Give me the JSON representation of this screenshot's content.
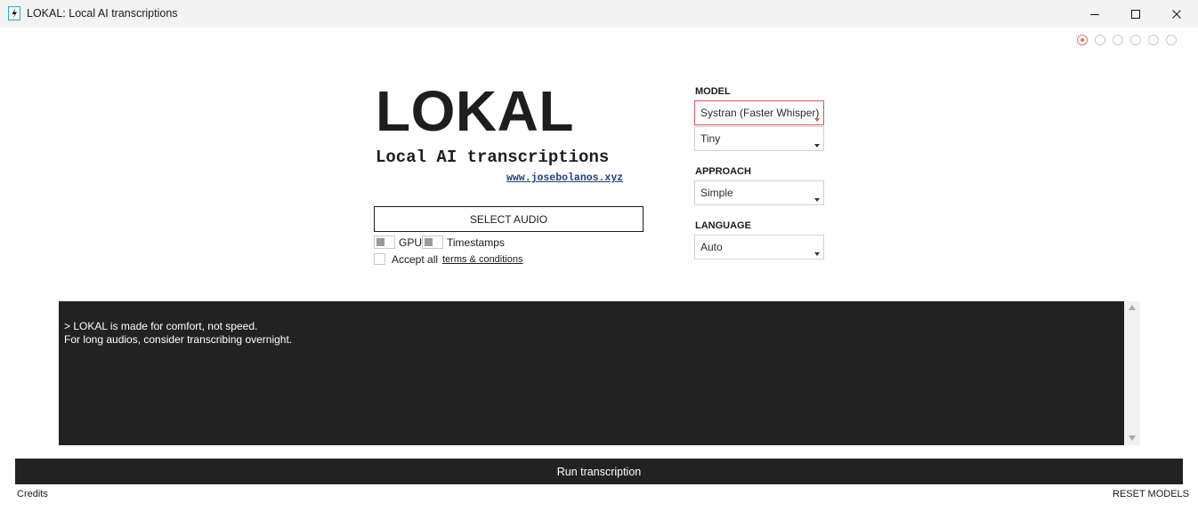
{
  "window": {
    "title": "LOKAL: Local AI transcriptions",
    "minimize_icon": "minimize-icon",
    "maximize_icon": "maximize-icon",
    "close_icon": "close-icon"
  },
  "steps": {
    "total": 6,
    "active_index": 0,
    "accent": "#e57373"
  },
  "brand": {
    "logo": "LOKAL",
    "subtitle": "Local AI transcriptions",
    "link": "www.josebolanos.xyz"
  },
  "controls": {
    "select_audio_label": "SELECT AUDIO",
    "gpu_label": "GPU",
    "timestamps_label": "Timestamps",
    "accept_label": "Accept all",
    "terms_label": "terms & conditions"
  },
  "settings": {
    "model_label": "MODEL",
    "model_value": "Systran (Faster Whisper)",
    "size_value": "Tiny",
    "approach_label": "APPROACH",
    "approach_value": "Simple",
    "language_label": "LANGUAGE",
    "language_value": "Auto"
  },
  "console": {
    "text": "> LOKAL is made for comfort, not speed.\nFor long audios, consider transcribing overnight."
  },
  "footer": {
    "run_label": "Run transcription",
    "credits_label": "Credits",
    "reset_label": "RESET MODELS"
  },
  "colors": {
    "dark": "#222222",
    "focus": "#e05555",
    "link": "#1f3f7a"
  }
}
